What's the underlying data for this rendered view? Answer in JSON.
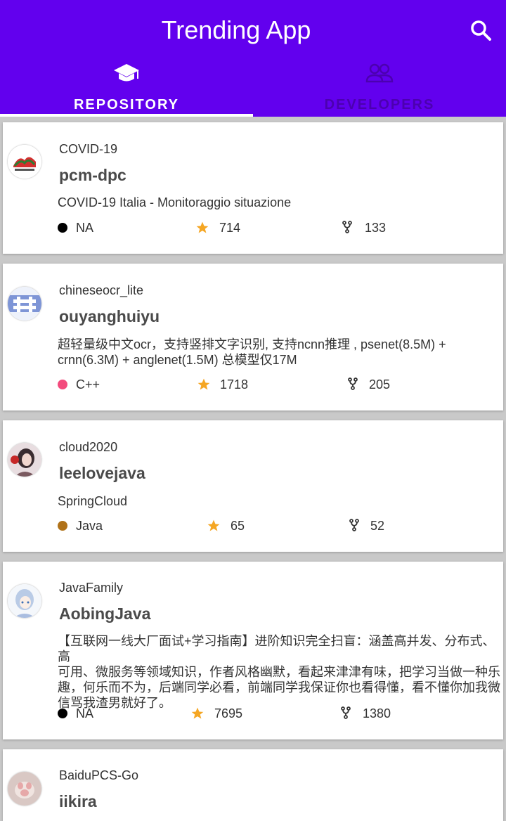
{
  "app": {
    "title": "Trending App"
  },
  "tabs": [
    {
      "label": "REPOSITORY",
      "icon": "graduation-cap-icon",
      "active": true
    },
    {
      "label": "DEVELOPERS",
      "icon": "people-icon",
      "active": false
    }
  ],
  "colors": {
    "primary": "#6200ee",
    "star": "#f5a623"
  },
  "repos": [
    {
      "owner": "COVID-19",
      "name": "pcm-dpc",
      "description": "COVID-19 Italia - Monitoraggio situazione",
      "language": "NA",
      "language_color": "#000000",
      "stars": "714",
      "forks": "133"
    },
    {
      "owner": "chineseocr_lite",
      "name": "ouyanghuiyu",
      "description_lines": [
        "超轻量级中文ocr，支持竖排文字识别, 支持ncnn推理 , psenet(8.5M) +",
        "crnn(6.3M) + anglenet(1.5M) 总模型仅17M"
      ],
      "language": "C++",
      "language_color": "#f34b7d",
      "stars": "1718",
      "forks": "205"
    },
    {
      "owner": "cloud2020",
      "name": "leelovejava",
      "description": "SpringCloud",
      "language": "Java",
      "language_color": "#b07219",
      "stars": "65",
      "forks": "52"
    },
    {
      "owner": "JavaFamily",
      "name": "AobingJava",
      "description_lines": [
        "【互联网一线大厂面试+学习指南】进阶知识完全扫盲：涵盖高并发、分布式、高",
        "可用、微服务等领域知识，作者风格幽默，看起来津津有味，把学习当做一种乐",
        "趣，何乐而不为，后端同学必看，前端同学我保证你也看得懂，看不懂你加我微",
        "信骂我渣男就好了。"
      ],
      "language": "NA",
      "language_color": "#000000",
      "stars": "7695",
      "forks": "1380"
    },
    {
      "owner": "BaiduPCS-Go",
      "name": "iikira"
    }
  ]
}
